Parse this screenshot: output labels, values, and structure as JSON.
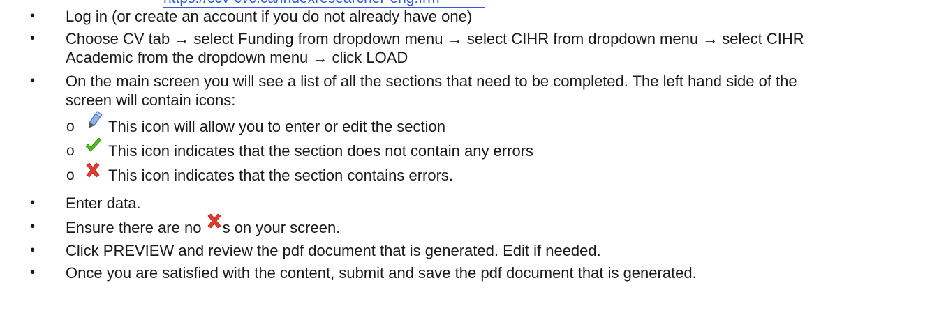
{
  "top_link": "https://ccv-cvc.ca/indexresearcher-eng.frm",
  "items": [
    {
      "text": "Log in (or create an account if you do not already have one)"
    },
    {
      "line1": "Choose CV tab → select Funding from dropdown menu → select CIHR from dropdown menu → select CIHR",
      "line2": "Academic from the dropdown menu → click LOAD"
    },
    {
      "line1": "On the main screen you will see a list of all the sections that need to be completed.  The left hand side of the",
      "line2": "screen will contain icons:"
    }
  ],
  "sub_items": [
    {
      "icon": "pencil-icon",
      "text": "This icon will allow you to enter or edit the section"
    },
    {
      "icon": "checkmark-icon",
      "text": "This icon indicates that the section does not contain any errors"
    },
    {
      "icon": "red-x-icon",
      "text": "This icon indicates that the section contains errors."
    }
  ],
  "more_items": {
    "enter_data": "Enter data.",
    "ensure_before": "Ensure there are no ",
    "ensure_after": "s on your screen.",
    "preview": "Click PREVIEW and review the pdf document that is generated.  Edit if needed.",
    "submit": "Once you are satisfied with the content, submit and save the pdf document that is generated."
  },
  "colors": {
    "link": "#2f5cd6",
    "check": "#4cbb17",
    "cross": "#e23a2e",
    "pencil": "#5b8fd6"
  }
}
